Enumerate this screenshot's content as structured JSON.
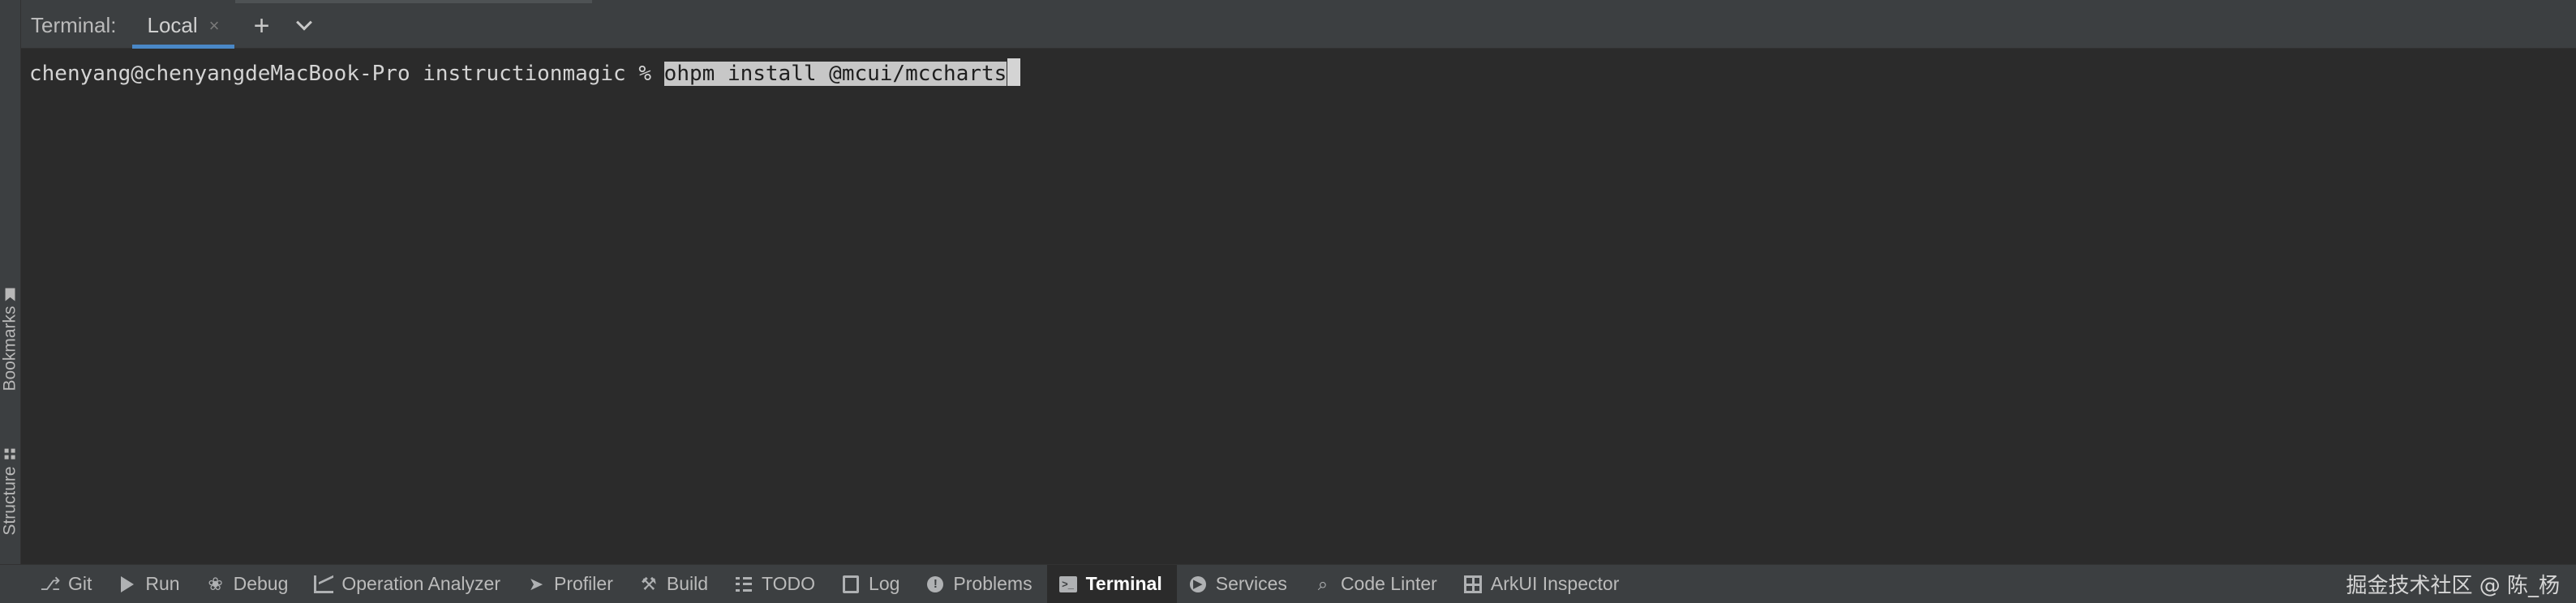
{
  "sidebar": {
    "bookmarks_label": "Bookmarks",
    "structure_label": "Structure"
  },
  "terminal": {
    "title": "Terminal:",
    "tabs": [
      {
        "label": "Local",
        "close_icon": "×"
      }
    ],
    "add_tab_icon": "+",
    "prompt": "chenyang@chenyangdeMacBook-Pro instructionmagic % ",
    "command": "ohpm install @mcui/mccharts"
  },
  "bottom_bar": {
    "tools": [
      {
        "label": "Git",
        "icon": "git-branch-icon"
      },
      {
        "label": "Run",
        "icon": "run-icon"
      },
      {
        "label": "Debug",
        "icon": "bug-icon"
      },
      {
        "label": "Operation Analyzer",
        "icon": "chart-icon"
      },
      {
        "label": "Profiler",
        "icon": "paper-plane-icon"
      },
      {
        "label": "Build",
        "icon": "hammer-icon"
      },
      {
        "label": "TODO",
        "icon": "list-icon"
      },
      {
        "label": "Log",
        "icon": "log-icon"
      },
      {
        "label": "Problems",
        "icon": "warning-icon"
      },
      {
        "label": "Terminal",
        "icon": "terminal-icon",
        "active": true
      },
      {
        "label": "Services",
        "icon": "services-icon"
      },
      {
        "label": "Code Linter",
        "icon": "code-linter-icon"
      },
      {
        "label": "ArkUI Inspector",
        "icon": "table-icon"
      }
    ]
  },
  "watermark": "掘金技术社区 @ 陈_杨",
  "colors": {
    "background": "#2b2b2b",
    "panel": "#3c3f41",
    "accent": "#4a88c7",
    "selection": "#c7c7c7"
  }
}
